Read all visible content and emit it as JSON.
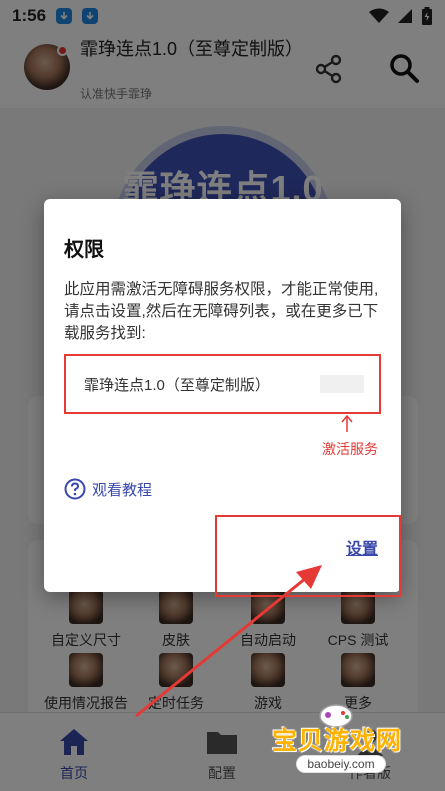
{
  "status_bar": {
    "time": "1:56",
    "icons": [
      "download-icon",
      "download-icon",
      "wifi-icon",
      "signal-icon",
      "battery-icon"
    ]
  },
  "header": {
    "title": "霏琤连点1.0（至尊定制版）",
    "subtitle": "认准快手霏琤",
    "icons": [
      "share-icon",
      "search-icon"
    ]
  },
  "background": {
    "hero_text": "霏琤连点1.0",
    "grid_row1": [
      "自定义尺寸",
      "皮肤",
      "自动启动",
      "CPS 测试"
    ],
    "grid_row2": [
      "使用情况报告",
      "定时任务",
      "游戏",
      "更多"
    ]
  },
  "bottom_nav": {
    "items": [
      {
        "label": "首页",
        "icon": "home-icon",
        "active": true
      },
      {
        "label": "配置",
        "icon": "folder-icon",
        "active": false
      },
      {
        "label": "作者版",
        "icon": "user-icon",
        "active": false
      }
    ]
  },
  "dialog": {
    "title": "权限",
    "message": "此应用需激活无障碍服务权限，才能正常使用,请点击设置,然后在无障碍列表，或在更多已下载服务找到:",
    "service_name": "霏琤连点1.0（至尊定制版）",
    "hint_label": "激活服务",
    "tutorial_label": "观看教程",
    "settings_label": "设置"
  },
  "watermark": {
    "text": "宝贝游戏网",
    "url": "baobeiy.com"
  },
  "colors": {
    "accent": "#3949ab",
    "highlight": "#e53935",
    "hero": "#3f51b5"
  }
}
